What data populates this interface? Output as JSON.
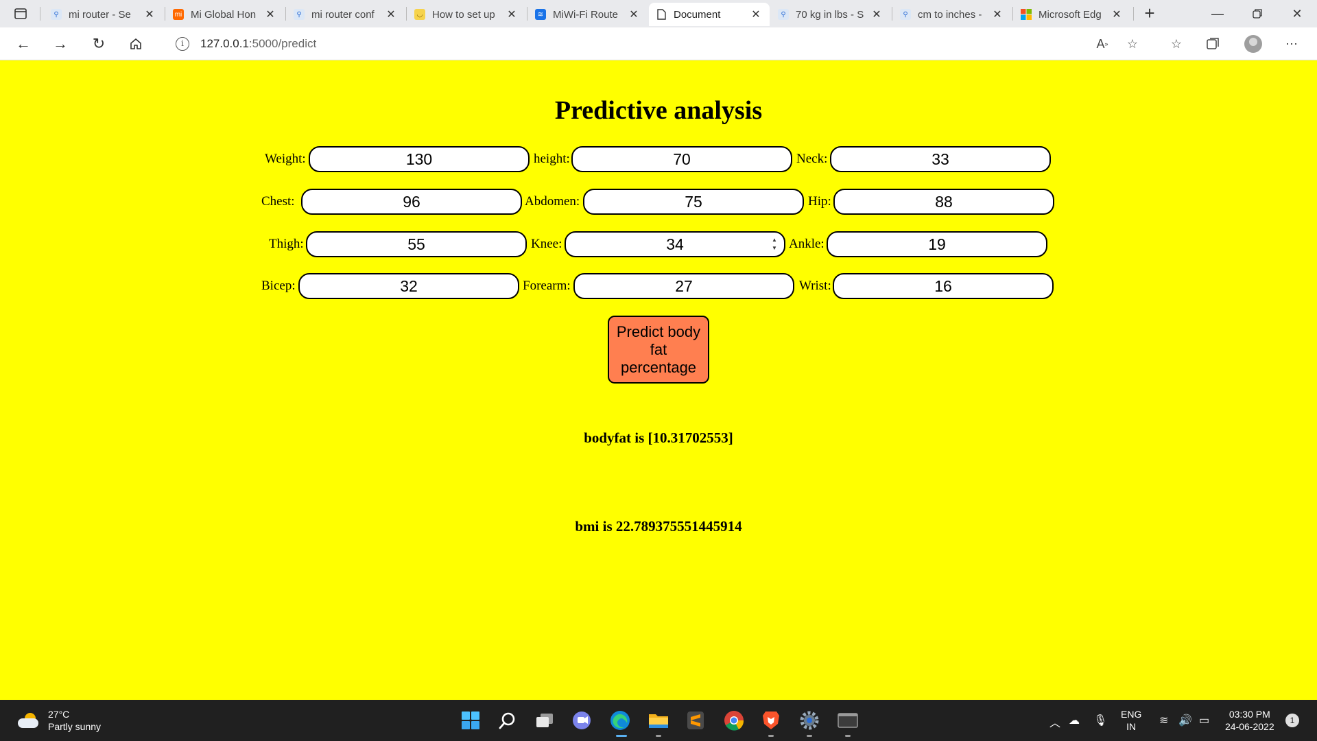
{
  "browser": {
    "tabs": [
      {
        "title": "mi router - Se",
        "icon": "search-icon",
        "active": false
      },
      {
        "title": "Mi Global Hon",
        "icon": "mi-logo-icon",
        "active": false
      },
      {
        "title": "mi router conf",
        "icon": "search-icon",
        "active": false
      },
      {
        "title": "How to set up",
        "icon": "smile-icon",
        "active": false
      },
      {
        "title": "MiWi-Fi Route",
        "icon": "wifi-icon",
        "active": false
      },
      {
        "title": "Document",
        "icon": "document-icon",
        "active": true
      },
      {
        "title": "70 kg in lbs - S",
        "icon": "search-icon",
        "active": false
      },
      {
        "title": "cm to inches -",
        "icon": "search-icon",
        "active": false
      },
      {
        "title": "Microsoft Edg",
        "icon": "microsoft-logo-icon",
        "active": false
      }
    ],
    "url_host": "127.0.0.1",
    "url_path": ":5000/predict",
    "close_glyph": "✕",
    "new_tab_glyph": "+"
  },
  "page": {
    "heading": "Predictive analysis",
    "fields": [
      {
        "label": "Weight:",
        "value": "130"
      },
      {
        "label": "height:",
        "value": "70"
      },
      {
        "label": "Neck:",
        "value": "33"
      },
      {
        "label": "Chest:",
        "value": "96"
      },
      {
        "label": "Abdomen:",
        "value": "75"
      },
      {
        "label": "Hip:",
        "value": "88"
      },
      {
        "label": "Thigh:",
        "value": "55"
      },
      {
        "label": "Knee:",
        "value": "34"
      },
      {
        "label": "Ankle:",
        "value": "19"
      },
      {
        "label": "Bicep:",
        "value": "32"
      },
      {
        "label": "Forearm:",
        "value": "27"
      },
      {
        "label": "Wrist:",
        "value": "16"
      }
    ],
    "predict_button": "Predict body fat percentage",
    "bodyfat_result": "bodyfat is [10.31702553]",
    "bmi_result": "bmi is 22.789375551445914"
  },
  "taskbar": {
    "weather_temp": "27°C",
    "weather_desc": "Partly sunny",
    "language": "ENG",
    "region": "IN",
    "time": "03:30 PM",
    "date": "24-06-2022",
    "notification_count": "1"
  },
  "colors": {
    "page_background": "#ffff00",
    "button_background": "#ff7f50"
  }
}
